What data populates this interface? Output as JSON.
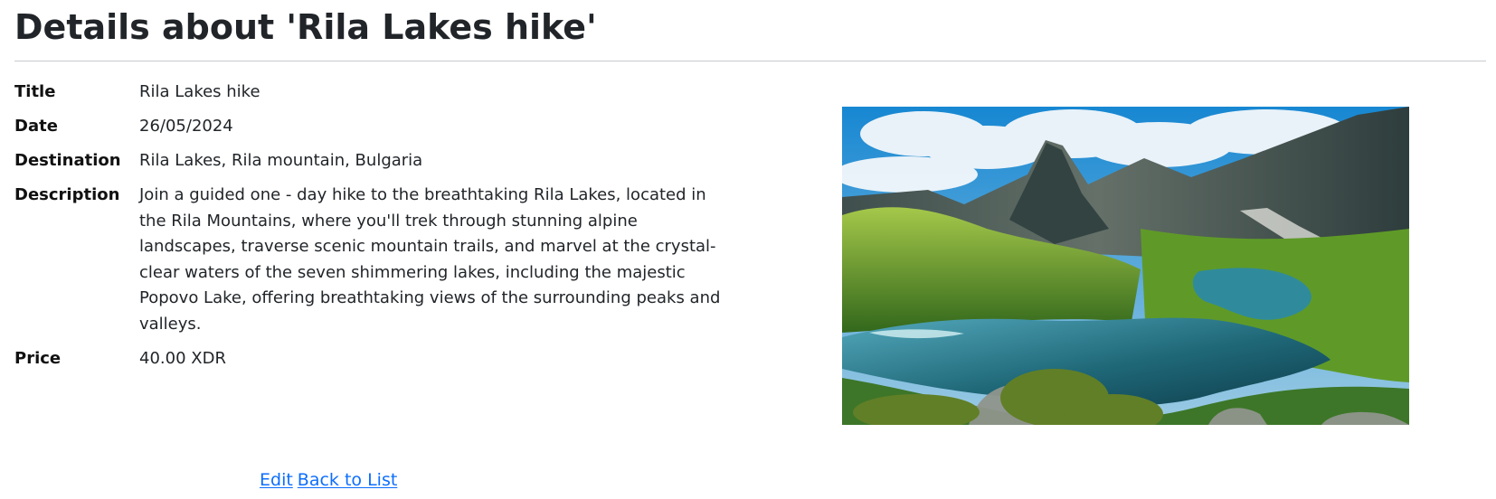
{
  "page": {
    "title": "Details about 'Rila Lakes hike'"
  },
  "details": {
    "title_label": "Title",
    "title_value": "Rila Lakes hike",
    "date_label": "Date",
    "date_value": "26/05/2024",
    "destination_label": "Destination",
    "destination_value": "Rila Lakes, Rila mountain, Bulgaria",
    "description_label": "Description",
    "description_value": "Join a guided one - day hike to the breathtaking Rila Lakes, located in the Rila Mountains, where you'll trek through stunning alpine landscapes, traverse scenic mountain trails, and marvel at the crystal-clear waters of the seven shimmering lakes, including the majestic Popovo Lake, offering breathtaking views of the surrounding peaks and valleys.",
    "price_label": "Price",
    "price_value": "40.00 XDR"
  },
  "image": {
    "alt": "Rila Lakes mountain lake landscape",
    "sky_color": "#3d9bd7",
    "cloud_color": "#f4f8fb",
    "mountain_color": "#495b56",
    "grass_color": "#5f9a28",
    "lake_color": "#1f6878"
  },
  "actions": {
    "edit_label": "Edit",
    "back_label": "Back to List"
  }
}
